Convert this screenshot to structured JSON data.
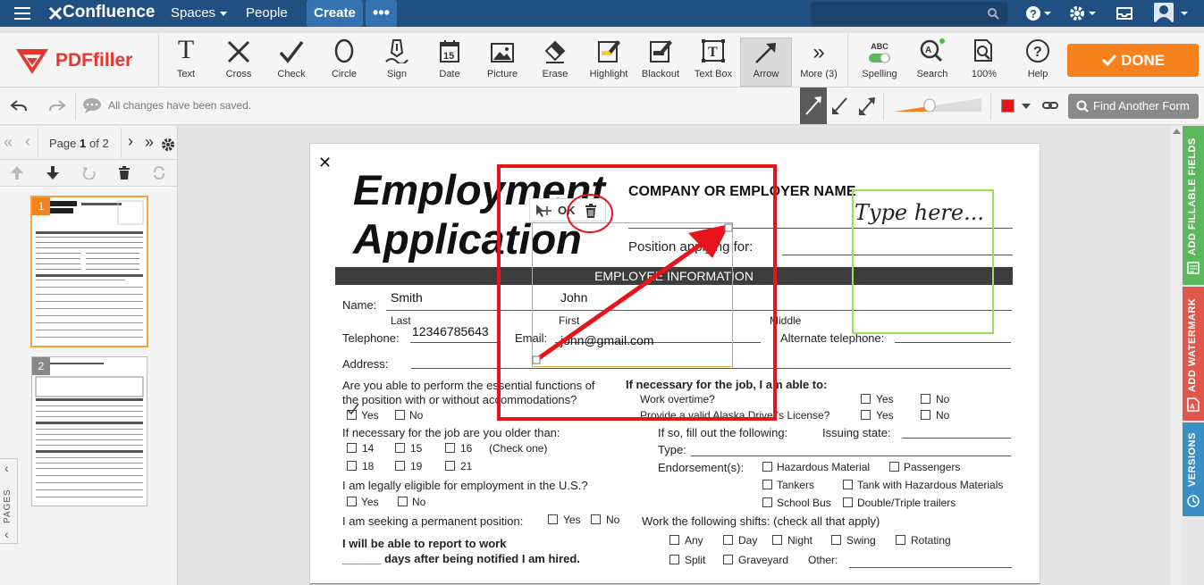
{
  "confluence": {
    "logo": "Confluence",
    "spaces": "Spaces",
    "people": "People",
    "create": "Create",
    "more": "•••"
  },
  "toolbar": {
    "brand": "PDFfiller",
    "tools": [
      "Text",
      "Cross",
      "Check",
      "Circle",
      "Sign",
      "Date",
      "Picture",
      "Erase",
      "Highlight",
      "Blackout",
      "Text Box",
      "Arrow",
      "More (3)"
    ],
    "spelling": "Spelling",
    "spelling_badge": "ABC",
    "search": "Search",
    "zoom": "100%",
    "help": "Help",
    "date_icon_text": "15",
    "textbox_icon_text": "T",
    "done": "DONE"
  },
  "statusbar": {
    "saved": "All changes have been saved.",
    "find_another": "Find Another Form",
    "color": "#e8141b"
  },
  "pager": {
    "page_label": "Page",
    "page_num": "1",
    "of_label": "of 2",
    "thumb1": "1",
    "thumb2": "2",
    "pages_tab": "PAGES"
  },
  "document": {
    "title1": "Employment",
    "title2": "Application",
    "company": "COMPANY OR EMPLOYER NAME",
    "position": "Position applying for:",
    "section": "EMPLOYEE INFORMATION",
    "name_label": "Name:",
    "last_value": "Smith",
    "first_value": "John",
    "last": "Last",
    "first": "First",
    "middle": "Middle",
    "telephone": "Telephone:",
    "tel_value": "12346785643",
    "email": "Email:",
    "email_value": "john@gmail.com",
    "alt_tel": "Alternate telephone:",
    "address": "Address:",
    "essential1": "Are you able to perform the essential functions of",
    "essential2": "the position with or without accommodations?",
    "yes": "Yes",
    "no": "No",
    "older": "If necessary for the job are you older than:",
    "ages1": [
      "14",
      "15",
      "16"
    ],
    "check_one": "(Check one)",
    "ages2": [
      "18",
      "19",
      "21"
    ],
    "eligible": "I am legally eligible for employment in the U.S.?",
    "seeking": "I am seeking a permanent position:",
    "report1": "I will be able to report to work",
    "report2": "______ days after being notified I am hired.",
    "if_necessary": "If necessary for the job, I am able to:",
    "overtime": "Work overtime?",
    "license": "Provide a valid Alaska Driver's License?",
    "if_so": "If so, fill out the following:",
    "issuing": "Issuing state:",
    "type": "Type:",
    "endorse": "Endorsement(s):",
    "endorsements": [
      "Hazardous Material",
      "Passengers",
      "Tankers",
      "Tank with Hazardous Materials",
      "School Bus",
      "Double/Triple trailers"
    ],
    "shifts": "Work the following shifts: (check all that apply)",
    "shift_list": [
      "Any",
      "Day",
      "Night",
      "Swing",
      "Rotating",
      "Split",
      "Graveyard"
    ],
    "other": "Other:",
    "type_here": "Type here...",
    "ok": "OK"
  },
  "rail": {
    "fillable": "ADD FILLABLE FIELDS",
    "watermark": "ADD WATERMARK",
    "versions": "VERSIONS"
  },
  "colors": {
    "confluence_bar": "#205081",
    "done": "#f7811d",
    "highlight_box": "#e8141b",
    "green_box": "#9be05a",
    "rail_green": "#5cb85c",
    "rail_red": "#e2574c",
    "rail_blue": "#3a8fc7"
  }
}
